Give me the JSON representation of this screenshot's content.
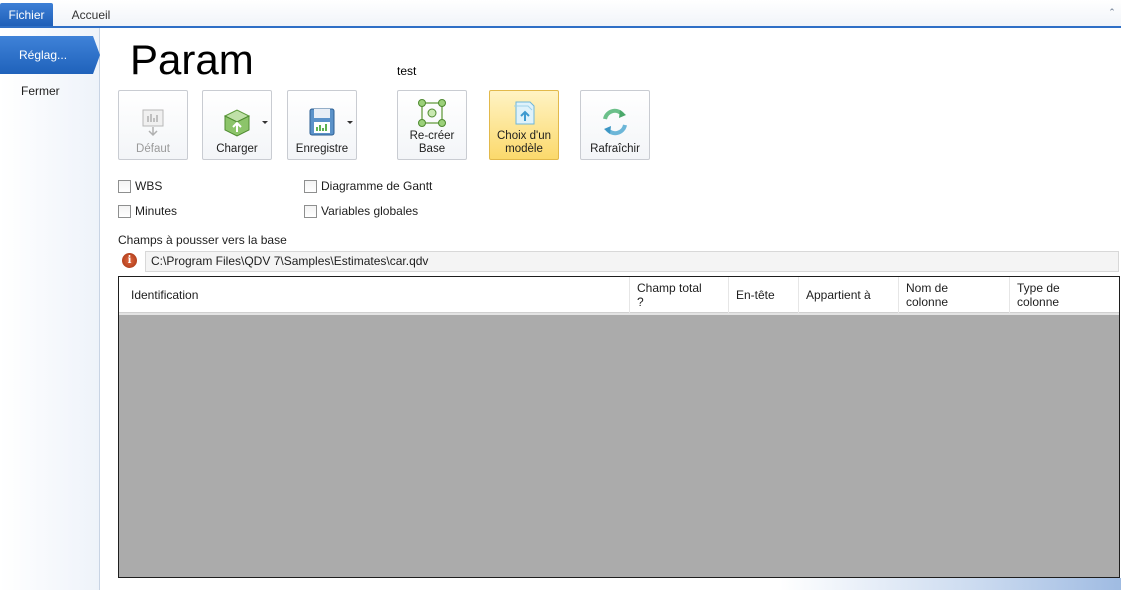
{
  "ribbon": {
    "file_tab": "Fichier",
    "home_tab": "Accueil"
  },
  "nav": {
    "active_item": "Réglag...",
    "close_item": "Fermer"
  },
  "page": {
    "title": "Param",
    "subtitle": "test"
  },
  "toolbar": {
    "default_label": "Défaut",
    "load_label": "Charger",
    "save_label": "Enregistre",
    "recreate_label_1": "Re-créer",
    "recreate_label_2": "Base",
    "choose_model_label_1": "Choix d'un",
    "choose_model_label_2": "modèle",
    "refresh_label": "Rafraîchir"
  },
  "options": {
    "wbs": "WBS",
    "minutes": "Minutes",
    "gantt": "Diagramme de Gantt",
    "global_vars": "Variables globales"
  },
  "fields": {
    "section_label": "Champs à pousser vers la base",
    "path": "C:\\Program Files\\QDV 7\\Samples\\Estimates\\car.qdv"
  },
  "grid": {
    "columns": [
      {
        "label": "Identification"
      },
      {
        "label": "Champ total ?"
      },
      {
        "label": "En-tête"
      },
      {
        "label": "Appartient à"
      },
      {
        "label": "Nom de colonne"
      },
      {
        "label": "Type de colonne"
      }
    ]
  },
  "colors": {
    "accent_blue": "#2f6fc6",
    "highlight_yellow": "#fbd96c",
    "grid_bg": "#ababab"
  },
  "icons": {
    "default": "chart-down-icon",
    "load": "box-upload-icon",
    "save": "floppy-chart-icon",
    "recreate": "database-nodes-icon",
    "choose_model": "template-upload-icon",
    "refresh": "refresh-arrows-icon",
    "info": "info-icon"
  }
}
